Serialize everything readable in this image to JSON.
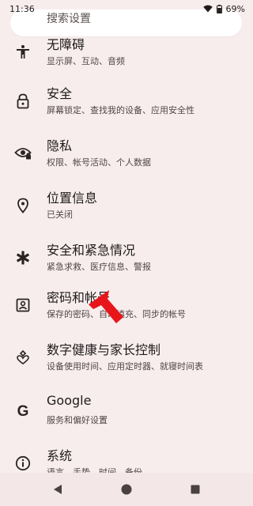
{
  "status_bar": {
    "time": "11:36",
    "battery": "69%"
  },
  "search": {
    "placeholder": "搜索设置"
  },
  "items": [
    {
      "title": "无障碍",
      "subtitle": "显示屏、互动、音频",
      "icon": "accessibility-icon"
    },
    {
      "title": "安全",
      "subtitle": "屏幕锁定、查找我的设备、应用安全性",
      "icon": "lock-icon"
    },
    {
      "title": "隐私",
      "subtitle": "权限、帐号活动、个人数据",
      "icon": "privacy-eye-icon"
    },
    {
      "title": "位置信息",
      "subtitle": "已关闭",
      "icon": "location-pin-icon"
    },
    {
      "title": "安全和紧急情况",
      "subtitle": "紧急求救、医疗信息、警报",
      "icon": "emergency-asterisk-icon"
    },
    {
      "title": "密码和帐号",
      "subtitle": "保存的密码、自动填充、同步的帐号",
      "icon": "account-box-icon"
    },
    {
      "title": "数字健康与家长控制",
      "subtitle": "设备使用时间、应用定时器、就寝时间表",
      "icon": "wellbeing-heart-icon"
    },
    {
      "title": "Google",
      "subtitle": "服务和偏好设置",
      "icon": "google-g-icon"
    },
    {
      "title": "系统",
      "subtitle": "语言、手势、时间、备份",
      "icon": "info-icon"
    }
  ],
  "annotation": {
    "icon": "red-arrow-pointer-icon",
    "color": "#e8161b"
  },
  "colors": {
    "background": "#f8eded",
    "search_bg": "#ffffff",
    "navbar_bg": "#f3e7e7"
  },
  "nav": {
    "back_icon": "back-triangle-icon",
    "home_icon": "home-circle-icon",
    "recents_icon": "recents-square-icon"
  }
}
